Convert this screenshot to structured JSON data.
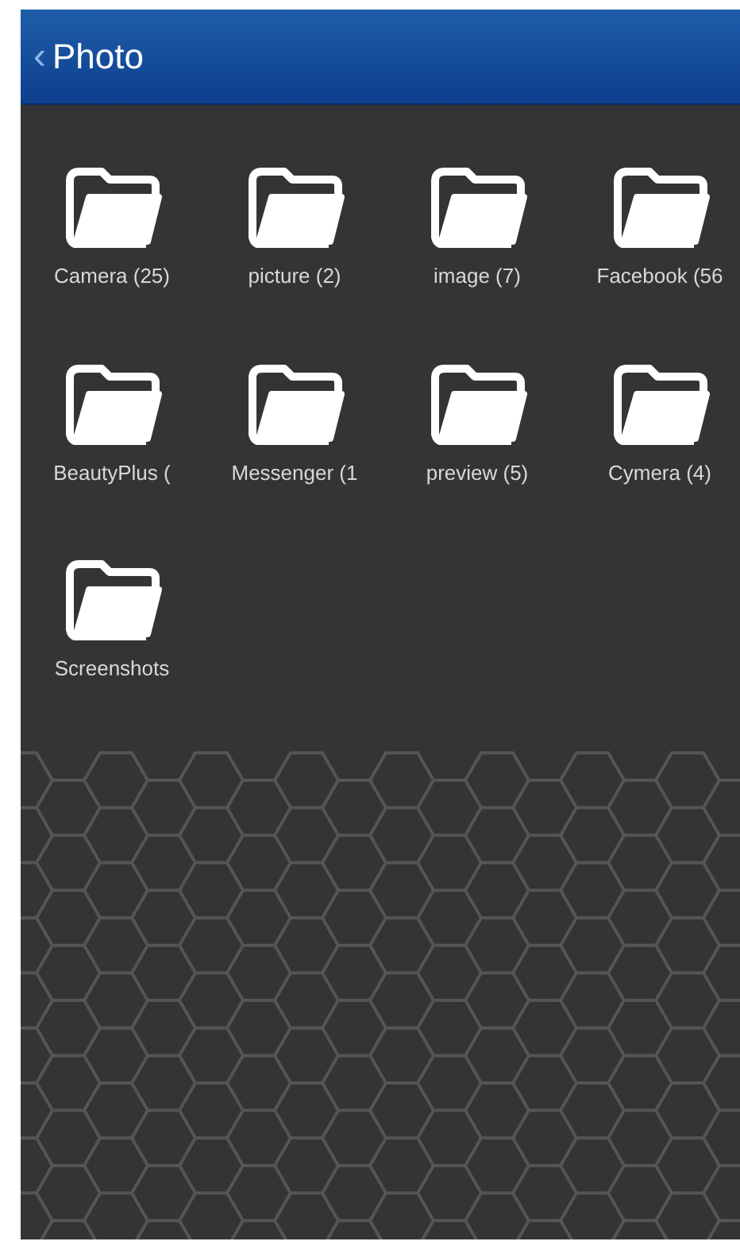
{
  "header": {
    "back": "‹",
    "title": "Photo"
  },
  "folders": [
    {
      "label": "Camera (25)"
    },
    {
      "label": "picture (2)"
    },
    {
      "label": "image (7)"
    },
    {
      "label": "Facebook (56"
    },
    {
      "label": "BeautyPlus ("
    },
    {
      "label": "Messenger (1"
    },
    {
      "label": "preview (5)"
    },
    {
      "label": "Cymera (4)"
    },
    {
      "label": "Screenshots"
    }
  ]
}
